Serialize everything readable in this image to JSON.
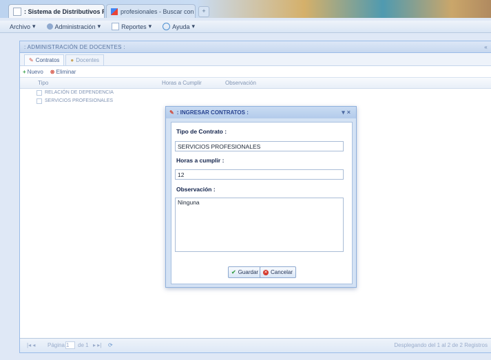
{
  "browser": {
    "tabs": [
      {
        "label": ": Sistema de Distributivos PUCES...",
        "close": "x"
      },
      {
        "label": "profesionales - Buscar con Google",
        "close": "x"
      }
    ],
    "new_tab": "+"
  },
  "menubar": {
    "items": [
      "Archivo",
      "Administración",
      "Reportes",
      "Ayuda"
    ]
  },
  "panel": {
    "title": ": ADMINISTRACIÓN DE DOCENTES :",
    "subtabs": [
      "Contratos",
      "Docentes"
    ],
    "toolbar": {
      "new": "Nuevo",
      "delete": "Eliminar"
    },
    "columns": [
      "Tipo",
      "Horas a Cumplir",
      "Observación"
    ],
    "rows": [
      "RELACIÓN DE DEPENDENCIA",
      "SERVICIOS PROFESIONALES"
    ],
    "pager": {
      "page_label": "Página",
      "page_value": "1",
      "of_label": "de 1",
      "summary": "Desplegando del 1 al 2 de 2 Registros"
    }
  },
  "modal": {
    "title": ": INGRESAR CONTRATOS :",
    "fields": [
      {
        "label": "Tipo de Contrato :",
        "value": "SERVICIOS PROFESIONALES"
      },
      {
        "label": "Horas a cumplir :",
        "value": "12"
      },
      {
        "label": "Observación :",
        "value": "Ninguna"
      }
    ],
    "save_label": "Guardar",
    "cancel_label": "Cancelar"
  },
  "colors": {
    "panel_border": "#99bbe8",
    "modal_title": "#27428f",
    "accent": "#4a6694"
  }
}
